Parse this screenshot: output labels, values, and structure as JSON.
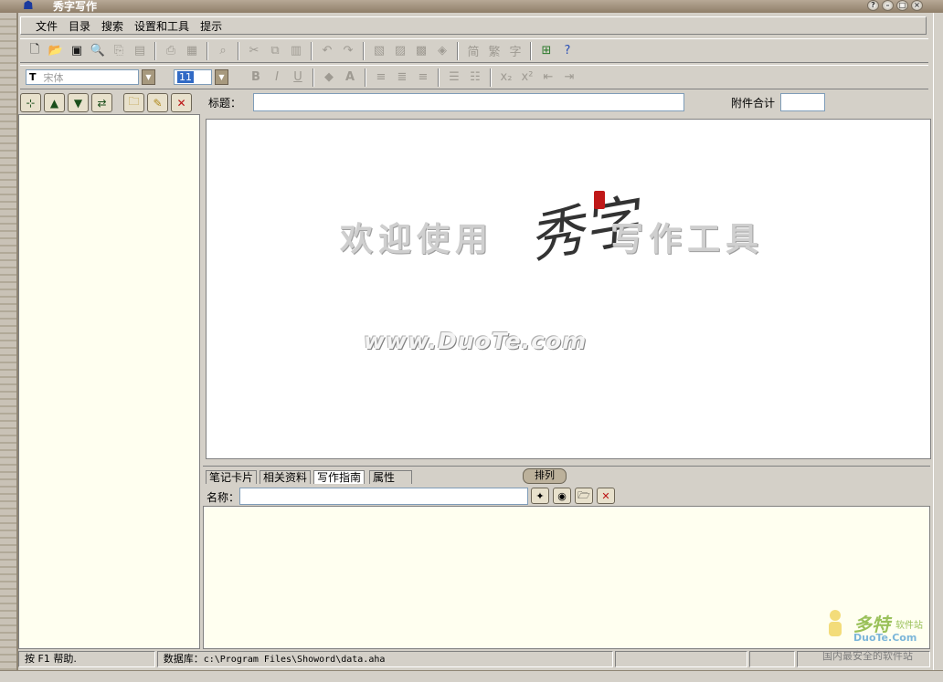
{
  "window": {
    "title": "秀字写作"
  },
  "menu": [
    "文件",
    "目录",
    "搜索",
    "设置和工具",
    "提示"
  ],
  "toolbar_icons": [
    "new-file-icon",
    "open-folder-icon",
    "save-icon",
    "preview-icon",
    "copy-note-icon",
    "paste-note-icon",
    "print-icon",
    "print-preview-icon",
    "find-icon",
    "cut-icon",
    "copy-icon",
    "paste-icon",
    "undo-icon",
    "redo-icon",
    "doc1-icon",
    "doc2-icon",
    "doc3-icon",
    "doc4-icon",
    "simplified-icon",
    "traditional-icon",
    "char-icon",
    "tree-icon",
    "help-icon"
  ],
  "format": {
    "font": "宋体",
    "size": "11",
    "bold": "B",
    "italic": "I",
    "underline": "U",
    "font_color": "A"
  },
  "left_toolbar_icons": [
    "select-icon",
    "up-arrow-icon",
    "down-arrow-icon",
    "move-icon",
    "new-folder-icon",
    "edit-folder-icon",
    "delete-folder-icon"
  ],
  "title_row": {
    "label": "标题：",
    "attachments_label": "附件合计"
  },
  "editor": {
    "welcome_left": "欢迎使用",
    "logo_text": "秀字",
    "welcome_right": "写作工具",
    "watermark": "www.DuoTe.com"
  },
  "tabs": [
    "笔记卡片",
    "相关资料",
    "写作指南",
    "属性"
  ],
  "sort_button": "排列",
  "name_row": {
    "label": "名称："
  },
  "status": {
    "help": "按 F1 帮助.",
    "db_label": "数据库：",
    "db_path": "c:\\Program Files\\Showord\\data.aha"
  },
  "brand": {
    "name": "多特",
    "name_suffix": "软件站",
    "domain": "DuoTe.Com",
    "slogan": "国内最安全的软件站"
  }
}
